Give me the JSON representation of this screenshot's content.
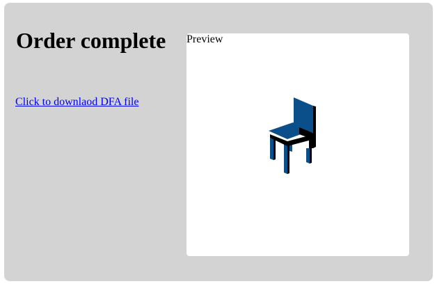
{
  "header": {
    "title": "Order complete"
  },
  "download": {
    "link_text": "Click to downlaod DFA file"
  },
  "preview": {
    "label": "Preview",
    "model": "chair-3d-model"
  },
  "colors": {
    "panel_bg": "#d3d3d3",
    "preview_bg": "#ffffff",
    "link": "#0000ee",
    "chair_front": "#0b4f8a",
    "chair_side": "#000000"
  }
}
